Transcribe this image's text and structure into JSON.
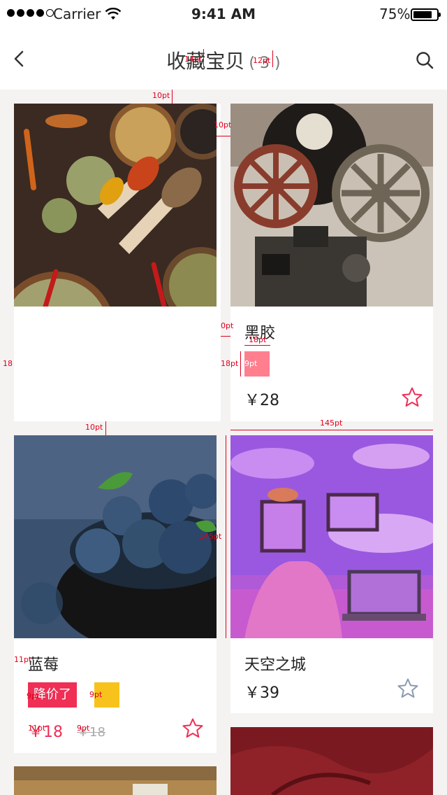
{
  "status_bar": {
    "carrier": "Carrier",
    "time": "9:41 AM",
    "battery": "75%",
    "battery_level": 0.75
  },
  "nav": {
    "title": "收藏宝贝",
    "count": "( 3 )"
  },
  "colors": {
    "accent": "#ef2f55",
    "tag_yellow": "#f7c21c"
  },
  "cards": [
    {
      "name": "",
      "image": "spices"
    },
    {
      "name": "黑胶",
      "price": "￥28",
      "image": "film-projector",
      "favorited": true
    },
    {
      "name": "蓝莓",
      "tag": "降价了",
      "price": "￥18",
      "old_price": "￥18",
      "image": "blueberries",
      "favorited": true
    },
    {
      "name": "天空之城",
      "price": "￥39",
      "image": "sky-city",
      "favorited": false
    }
  ],
  "annotations": {
    "a_14pt": "14pt",
    "a_12pt": "12pt",
    "a_10pt_top": "10pt",
    "a_10pt_right": "10pt",
    "a_10pt_gap": "0pt",
    "a_18pt_w": "18pt",
    "a_18pt_h": "18pt",
    "a_9pt": "9pt",
    "a_18_left": "18",
    "a_10pt_mid": "10pt",
    "a_145pt_w": "145pt",
    "a_145pt_h": "145pt",
    "a_11pt_name": "11pt",
    "a_9pt_tag": "9pt",
    "a_9pt_tag2": "9pt",
    "a_11pt_price": "11pt",
    "a_9pt_old": "9pt"
  }
}
